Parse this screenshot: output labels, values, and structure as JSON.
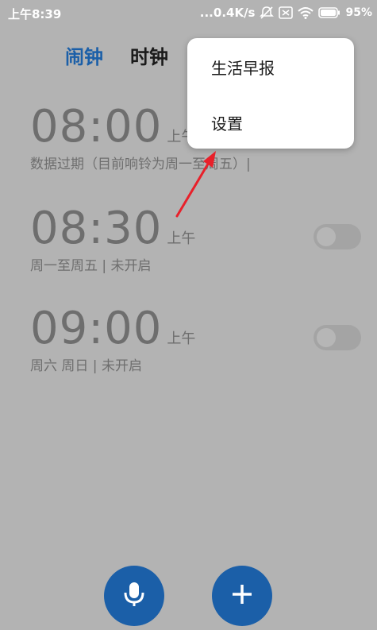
{
  "status_bar": {
    "time": "上午8:39",
    "network_speed": "...0.4K/s",
    "battery": "95%",
    "icons": [
      "mute-icon",
      "sim-icon",
      "wifi-icon",
      "battery-icon"
    ]
  },
  "tabs": [
    {
      "label": "闹钟",
      "active": true
    },
    {
      "label": "时钟",
      "active": false
    }
  ],
  "alarms": [
    {
      "time": "08:00",
      "ampm": "上午",
      "desc": "数据过期（目前响铃为周一至周五）|",
      "enabled": false
    },
    {
      "time": "08:30",
      "ampm": "上午",
      "desc": "周一至周五 | 未开启",
      "enabled": false
    },
    {
      "time": "09:00",
      "ampm": "上午",
      "desc": "周六 周日 | 未开启",
      "enabled": false
    }
  ],
  "menu": {
    "items": [
      "生活早报",
      "设置"
    ]
  },
  "colors": {
    "accent": "#1b5fa8",
    "overlay_background": "#b3b3b3",
    "annotation_arrow": "#e8202a"
  },
  "fabs": {
    "voice_icon": "microphone-icon",
    "add_icon": "plus-icon"
  }
}
